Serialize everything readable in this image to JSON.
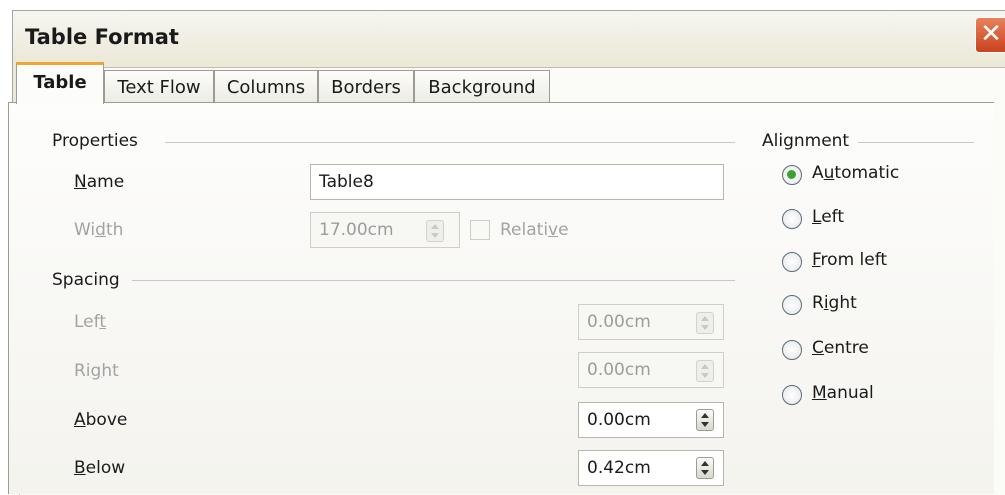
{
  "window": {
    "title": "Table Format",
    "close_glyph": "✕"
  },
  "tabs": [
    {
      "label": "Table",
      "active": true
    },
    {
      "label": "Text Flow",
      "active": false
    },
    {
      "label": "Columns",
      "active": false
    },
    {
      "label": "Borders",
      "active": false
    },
    {
      "label": "Background",
      "active": false
    }
  ],
  "properties": {
    "heading": "Properties",
    "name_label": "Name",
    "name_value": "Table8",
    "width_label": "Width",
    "width_value": "17.00cm",
    "relative_label": "Relative",
    "relative_checked": false
  },
  "spacing": {
    "heading": "Spacing",
    "left_label": "Left",
    "left_value": "0.00cm",
    "right_label": "Right",
    "right_value": "0.00cm",
    "above_label": "Above",
    "above_value": "0.00cm",
    "below_label": "Below",
    "below_value": "0.42cm"
  },
  "alignment": {
    "heading": "Alignment",
    "options": [
      {
        "label": "Automatic",
        "selected": true
      },
      {
        "label": "Left",
        "selected": false
      },
      {
        "label": "From left",
        "selected": false
      },
      {
        "label": "Right",
        "selected": false
      },
      {
        "label": "Centre",
        "selected": false
      },
      {
        "label": "Manual",
        "selected": false
      }
    ]
  },
  "colors": {
    "accent_tab": "#f0a636",
    "radio_selected": "#3aa232",
    "close_button": "#c8431d"
  }
}
